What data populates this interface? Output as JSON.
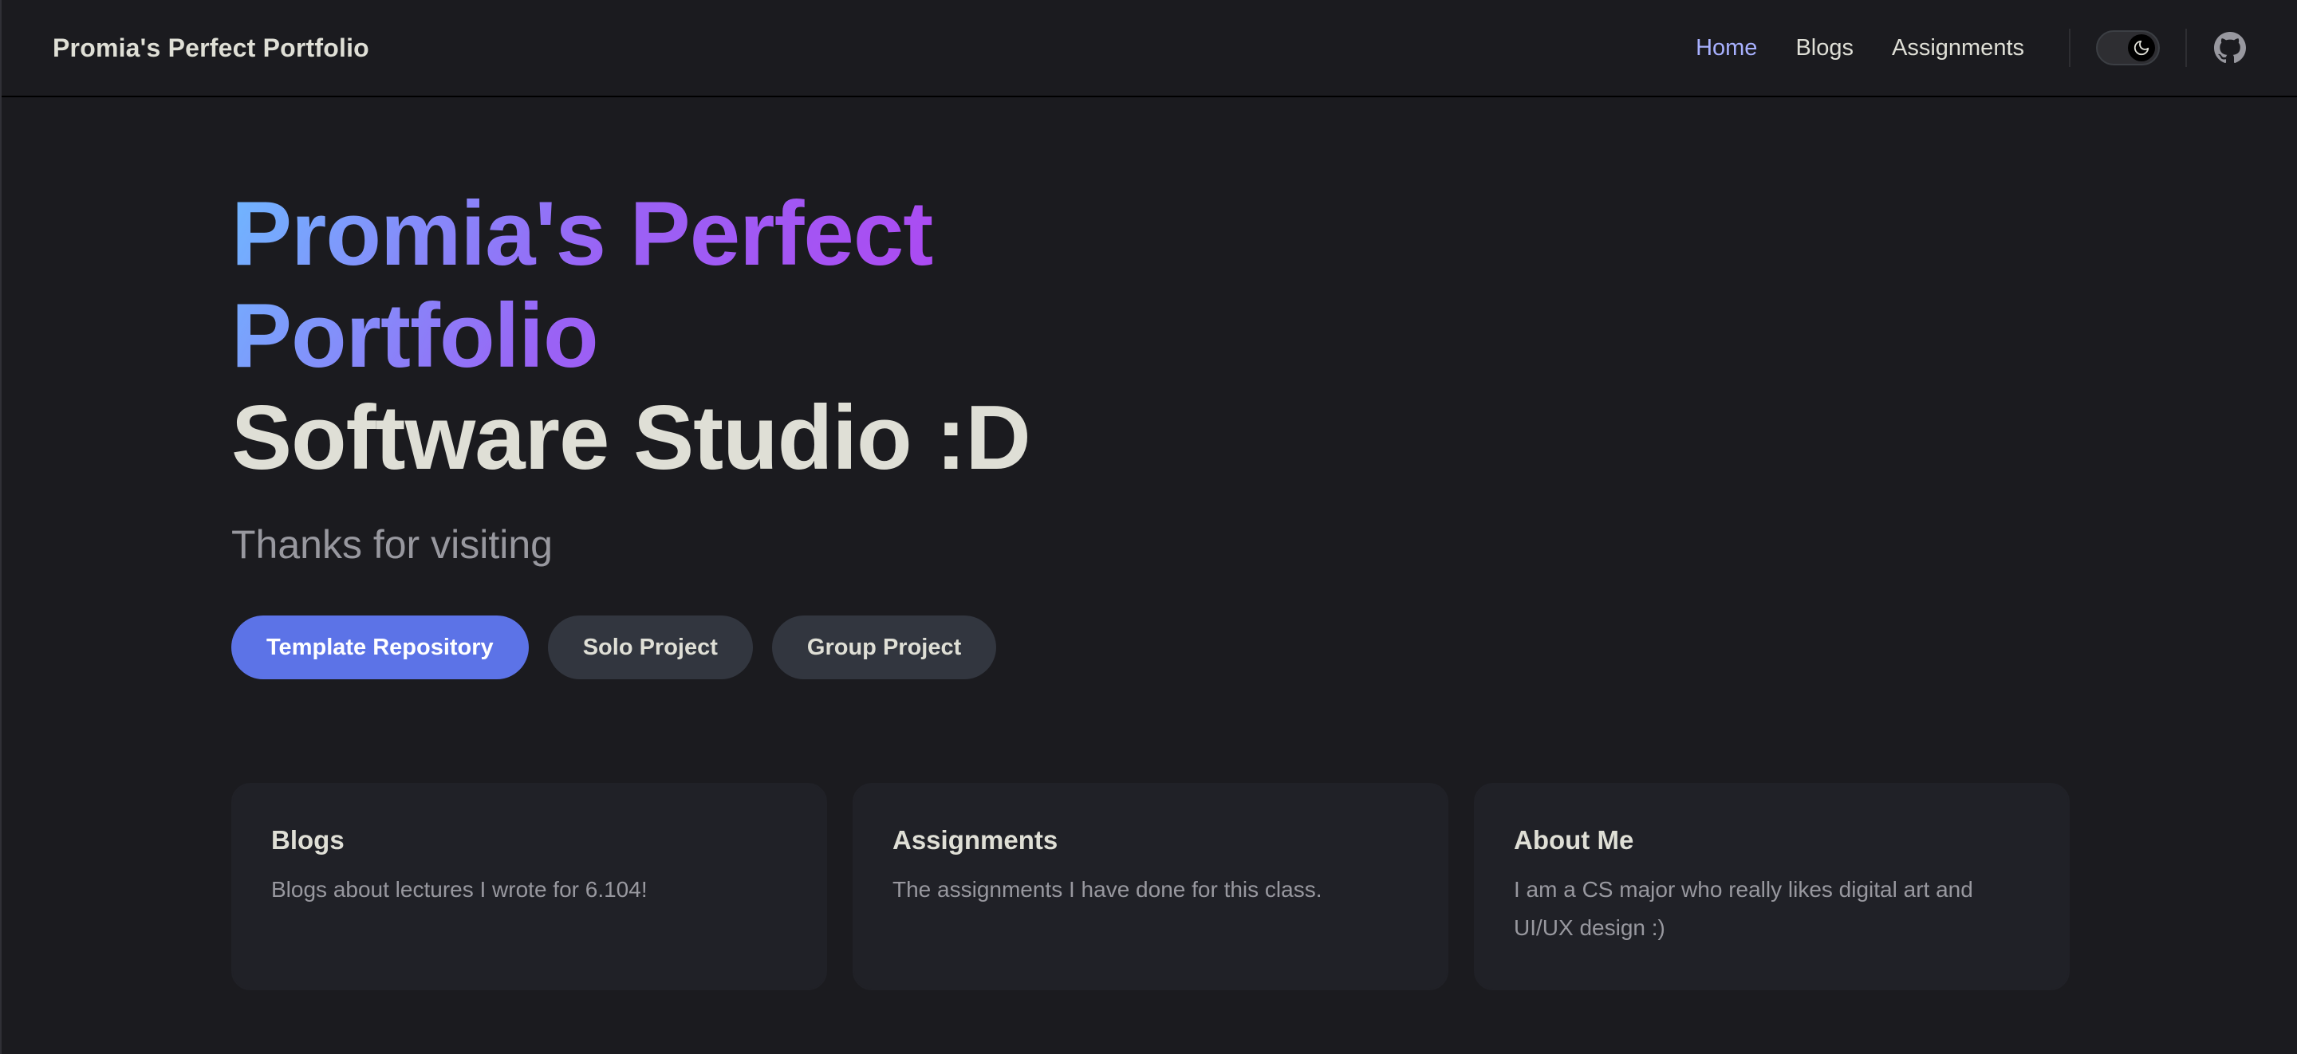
{
  "nav": {
    "brand": "Promia's Perfect Portfolio",
    "links": [
      {
        "label": "Home",
        "active": true
      },
      {
        "label": "Blogs",
        "active": false
      },
      {
        "label": "Assignments",
        "active": false
      }
    ],
    "theme_toggle_icon": "moon-icon",
    "social_icon": "github-icon"
  },
  "hero": {
    "name": "Promia's Perfect Portfolio",
    "text": "Software Studio :D",
    "tagline": "Thanks for visiting",
    "actions": [
      {
        "label": "Template Repository",
        "theme": "brand"
      },
      {
        "label": "Solo Project",
        "theme": "alt"
      },
      {
        "label": "Group Project",
        "theme": "alt"
      }
    ]
  },
  "features": [
    {
      "title": "Blogs",
      "details": "Blogs about lectures I wrote for 6.104!"
    },
    {
      "title": "Assignments",
      "details": "The assignments I have done for this class."
    },
    {
      "title": "About Me",
      "details": "I am a CS major who really likes digital art and UI/UX design :)"
    }
  ],
  "colors": {
    "background": "#1b1b1f",
    "brand": "#5c73e7",
    "active_link": "#a8b1ff",
    "gradient_start": "#6fb7ff",
    "gradient_end": "#b43ff0"
  }
}
